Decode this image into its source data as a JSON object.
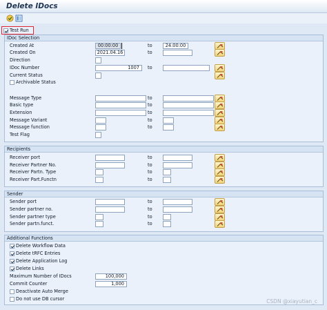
{
  "title": "Delete IDocs",
  "toolbar": {
    "execute_icon": "execute-icon",
    "variants_icon": "variants-icon"
  },
  "test_run": {
    "label": "Test Run",
    "checked": true
  },
  "idoc_selection": {
    "title": "IDoc Selection",
    "to_label": "to",
    "created_at": {
      "label": "Created At",
      "from": "00:00:00",
      "to": "24:00:00"
    },
    "created_on": {
      "label": "Created On",
      "from": "2021.04.16",
      "to": ""
    },
    "direction": {
      "label": "Direction",
      "from": ""
    },
    "idoc_number": {
      "label": "IDoc Number",
      "from": "1007",
      "to": ""
    },
    "current_status": {
      "label": "Current Status",
      "from": ""
    },
    "archivable_status": {
      "label": "Archivable Status",
      "checked": false
    },
    "message_type": {
      "label": "Message Type",
      "from": "",
      "to": ""
    },
    "basic_type": {
      "label": "Basic type",
      "from": "",
      "to": ""
    },
    "extension": {
      "label": "Extension",
      "from": "",
      "to": ""
    },
    "message_variant": {
      "label": "Message Variant",
      "from": "",
      "to": ""
    },
    "message_function": {
      "label": "Message function",
      "from": "",
      "to": ""
    },
    "test_flag": {
      "label": "Test Flag",
      "from": ""
    }
  },
  "recipients": {
    "title": "Recipients",
    "receiver_port": {
      "label": "Receiver port"
    },
    "receiver_partner_no": {
      "label": "Receiver Partner No."
    },
    "receiver_partn_type": {
      "label": "Receiver Partn. Type"
    },
    "receiver_part_functn": {
      "label": "Receiver Part.Functn"
    }
  },
  "sender": {
    "title": "Sender",
    "sender_port": {
      "label": "Sender port"
    },
    "sender_partner_no": {
      "label": "Sender partner no."
    },
    "sender_partner_type": {
      "label": "Sender partner type"
    },
    "sender_partn_funct": {
      "label": "Sender partn.funct."
    }
  },
  "additional": {
    "title": "Additional Functions",
    "delete_workflow_data": {
      "label": "Delete Workflow Data",
      "checked": true
    },
    "delete_trfc_entries": {
      "label": "Delete tRFC Entries",
      "checked": true
    },
    "delete_application_log": {
      "label": "Delete Application Log",
      "checked": true
    },
    "delete_links": {
      "label": "Delete Links",
      "checked": true
    },
    "max_idocs": {
      "label": "Maximum Number of IDocs",
      "value": "100,000"
    },
    "commit_counter": {
      "label": "Commit Counter",
      "value": "1,000"
    },
    "deactivate_auto_merge": {
      "label": "Deactivate Auto Merge",
      "checked": false
    },
    "do_not_use_db_cursor": {
      "label": "Do not use DB cursor",
      "checked": false
    }
  },
  "watermark": "CSDN @xiayutian_c"
}
